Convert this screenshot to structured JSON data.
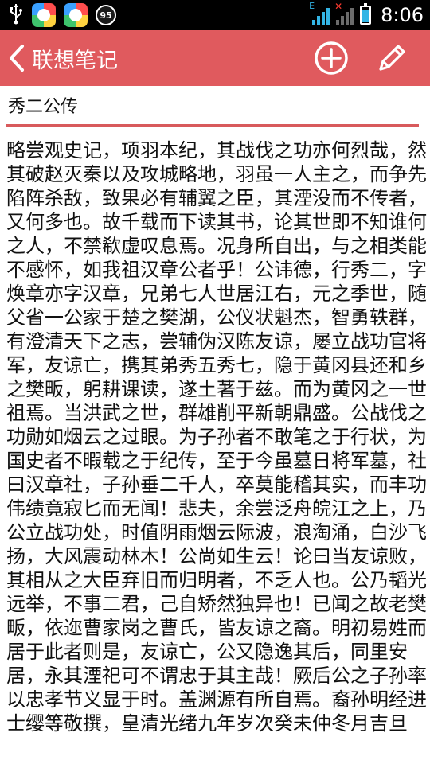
{
  "status_bar": {
    "notification_count": "95",
    "network_type": "E",
    "time": "8:06"
  },
  "action_bar": {
    "title": "联想笔记",
    "icons": [
      "back-arrow-icon",
      "add-circle-icon",
      "pencil-icon"
    ]
  },
  "note": {
    "title": "秀二公传",
    "body": "略尝观史记，项羽本纪，其战伐之功亦何烈哉，然其破赵灭秦以及攻城略地，羽虽一人主之，而争先陷阵杀敌，致果必有辅翼之臣，其湮没而不传者，又何多也。故千载而下读其书，论其世即不知谁何之人，不禁欷虚叹息焉。况身所自出，与之相类能不感怀，如我祖汉章公者乎！公讳德，行秀二，字焕章亦字汉章，兄弟七人世居江右，元之季世，随父省一公家于楚之樊湖，公仪状魁杰，智勇轶群，有澄清天下之志，尝辅伪汉陈友谅，屡立战功官将军，友谅亡，携其弟秀五秀七，隐于黄冈县还和乡之樊畈，躬耕课读，遂土著于兹。而为黄冈之一世祖焉。当洪武之世，群雄削平新朝鼎盛。公战伐之功勋如烟云之过眼。为子孙者不敢笔之于行状，为国史者不暇载之于纪传，至于今虽墓日将军墓，社曰汉章社，子孙垂二千人，卒莫能稽其实，而丰功伟绩竟寂匕而无闻！悲夫，余尝泛舟皖江之上，乃公立战功处，时值阴雨烟云际波，浪淘涌，白沙飞扬，大风震动林木！公尚如生云！论曰当友谅败，其相从之大臣弃旧而归明者，不乏人也。公乃韬光远举，不事二君，己自矫然独异也！已闻之故老樊畈，依迩曹家岗之曹氏，皆友谅之裔。明初易姓而居于此者则是，友谅亡，公又隐逸其后，同里安居，永其湮祀可不谓忠于其主哉！厥后公之子孙率以忠孝节义显于时。盖渊源有所自焉。裔孙明经进士缨等敬撰，皇清光绪九年岁次癸未仲冬月吉旦"
  },
  "colors": {
    "action_bar": "#e05a5e",
    "divider": "#d85a5c",
    "status_bar": "#000000",
    "status_accent": "#33b5e5"
  }
}
